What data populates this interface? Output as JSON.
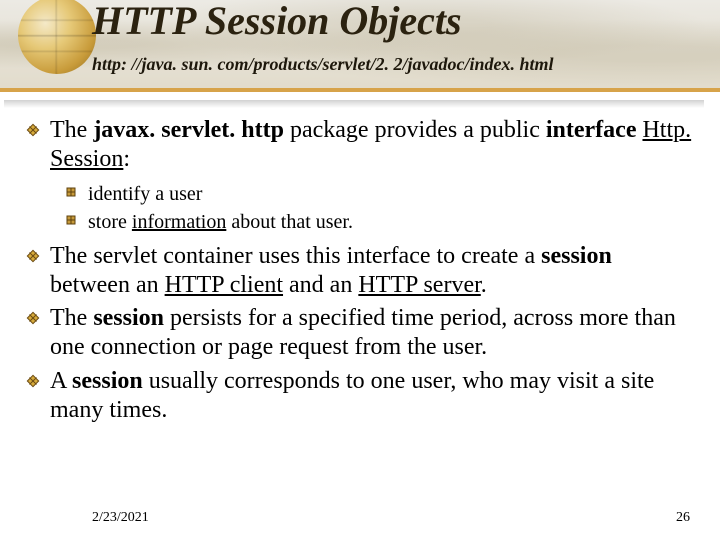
{
  "title": "HTTP Session Objects",
  "subtitle": "http: //java. sun. com/products/servlet/2. 2/javadoc/index. html",
  "p1": {
    "a": "The ",
    "b": "javax. servlet. http",
    "c": " package provides a public ",
    "d": "interface ",
    "e": "Http. Session",
    "f": ":"
  },
  "sub": {
    "s1": "identify a user",
    "s2a": "store ",
    "s2b": "information",
    "s2c": " about that user."
  },
  "p2": {
    "a": "The servlet container uses this interface to create a ",
    "b": "session",
    "c": " between an ",
    "d": "HTTP client",
    "e": " and an ",
    "f": "HTTP server",
    "g": "."
  },
  "p3": {
    "a": "The ",
    "b": "session",
    "c": " persists for a specified time period, across more than one connection or page request from the user."
  },
  "p4": {
    "a": "A ",
    "b": "session",
    "c": " usually corresponds to one user, who may visit a site many times."
  },
  "footer_date": "2/23/2021",
  "page_number": "26"
}
